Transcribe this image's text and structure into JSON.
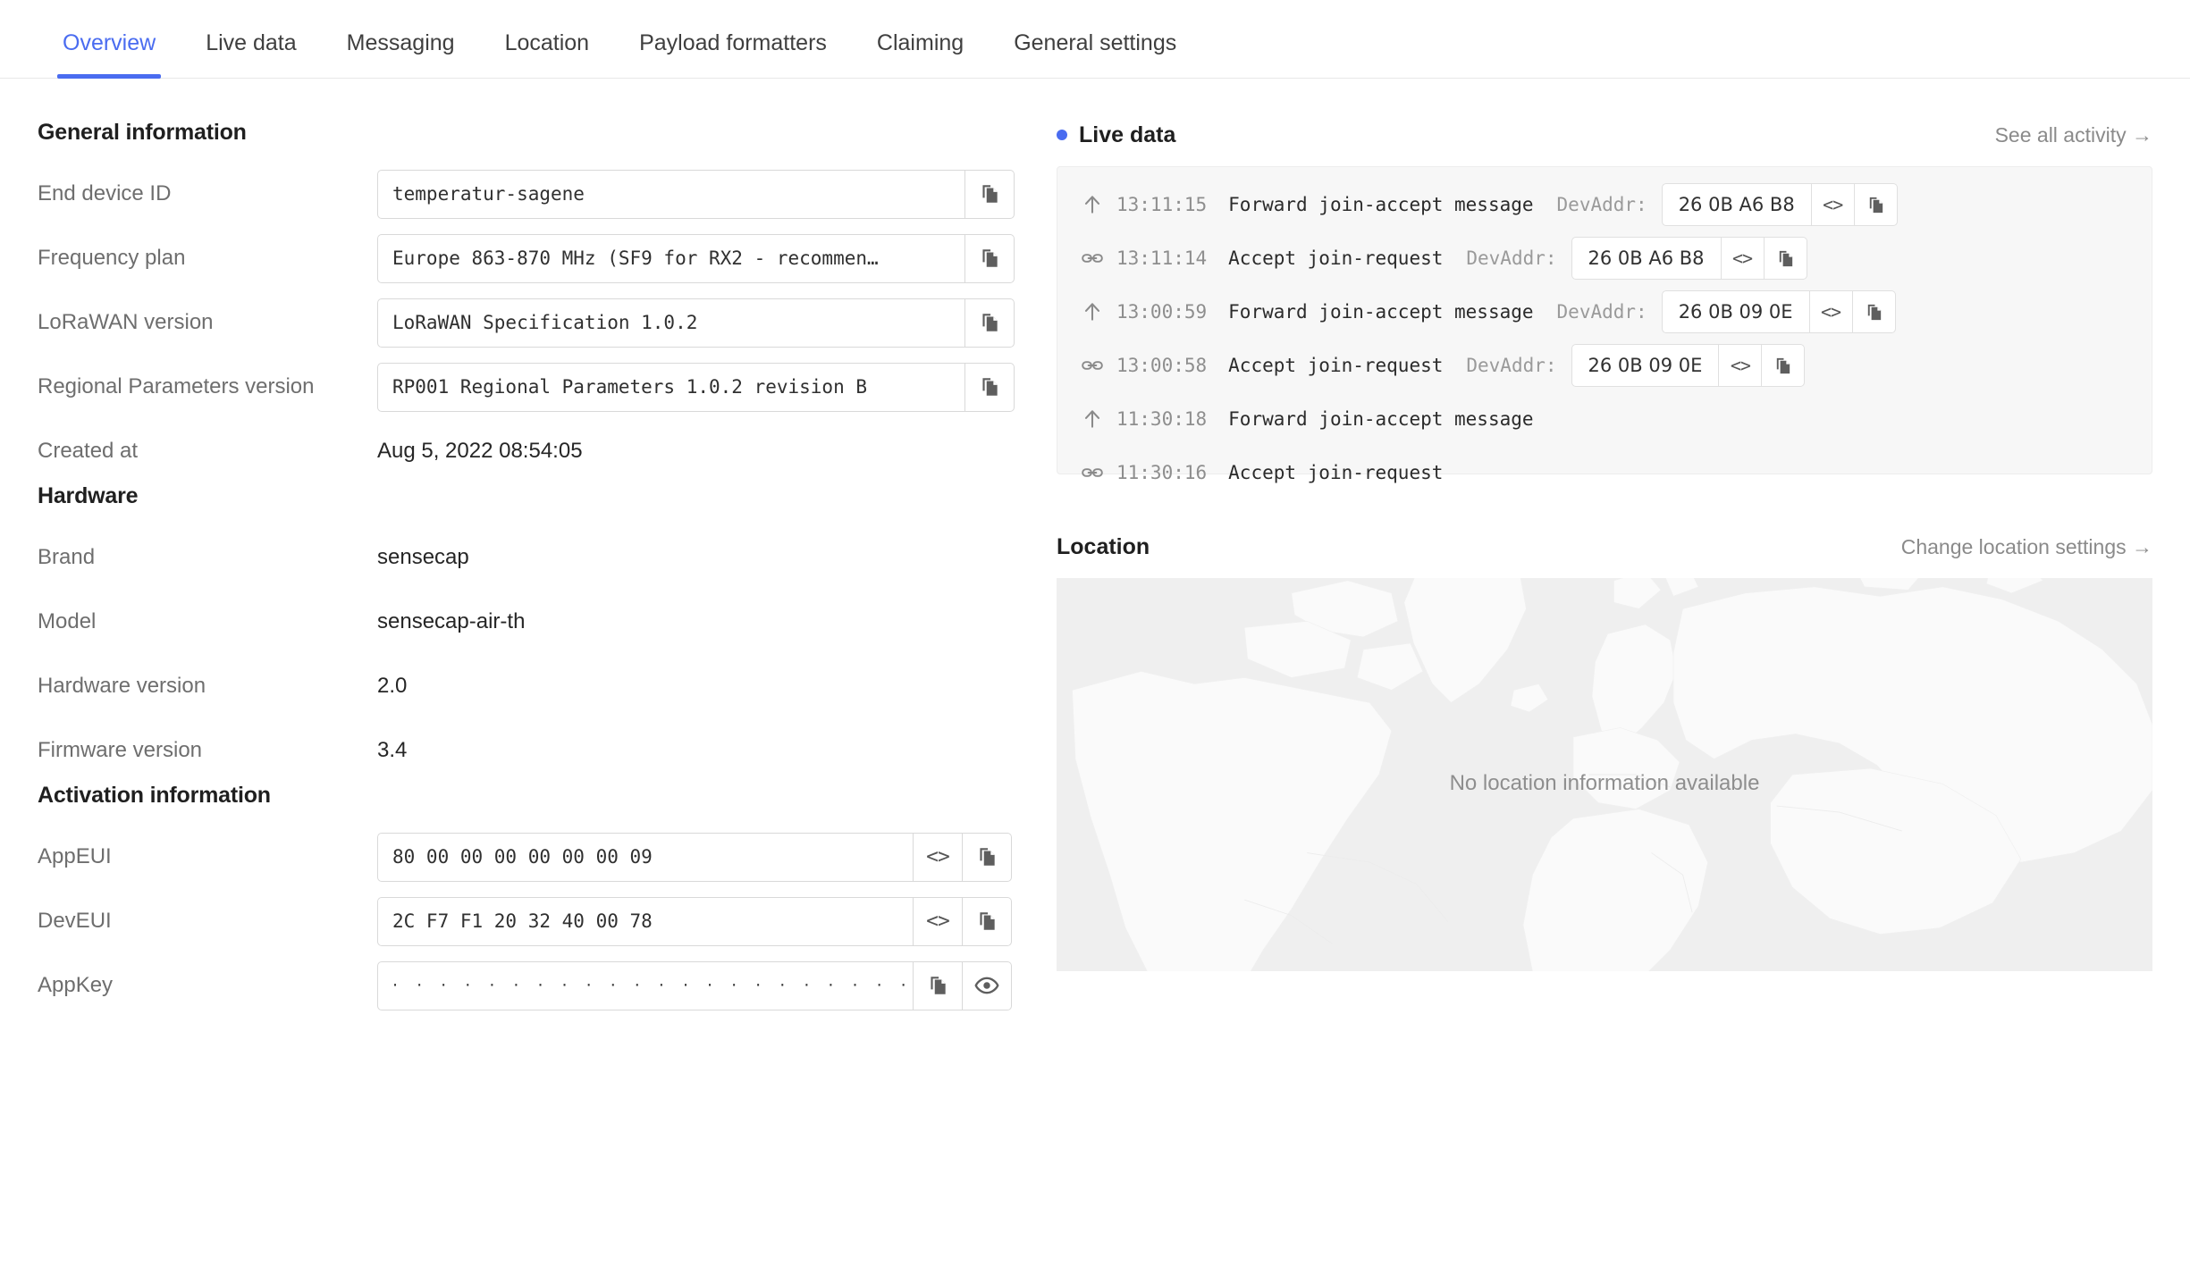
{
  "tabs": [
    {
      "label": "Overview",
      "active": true
    },
    {
      "label": "Live data",
      "active": false
    },
    {
      "label": "Messaging",
      "active": false
    },
    {
      "label": "Location",
      "active": false
    },
    {
      "label": "Payload formatters",
      "active": false
    },
    {
      "label": "Claiming",
      "active": false
    },
    {
      "label": "General settings",
      "active": false
    }
  ],
  "general": {
    "heading": "General information",
    "rows": [
      {
        "label": "End device ID",
        "value": "temperatur-sagene",
        "type": "input-copy"
      },
      {
        "label": "Frequency plan",
        "value": "Europe 863-870 MHz (SF9 for RX2 - recommen…",
        "type": "input-copy"
      },
      {
        "label": "LoRaWAN version",
        "value": "LoRaWAN Specification 1.0.2",
        "type": "input-copy"
      },
      {
        "label": "Regional Parameters version",
        "value": "RP001 Regional Parameters 1.0.2 revision B",
        "type": "input-copy"
      },
      {
        "label": "Created at",
        "value": "Aug 5, 2022 08:54:05",
        "type": "plain"
      }
    ]
  },
  "hardware": {
    "heading": "Hardware",
    "rows": [
      {
        "label": "Brand",
        "value": "sensecap"
      },
      {
        "label": "Model",
        "value": "sensecap-air-th"
      },
      {
        "label": "Hardware version",
        "value": "2.0"
      },
      {
        "label": "Firmware version",
        "value": "3.4"
      }
    ]
  },
  "activation": {
    "heading": "Activation information",
    "rows": [
      {
        "label": "AppEUI",
        "value": "80 00 00 00 00 00 00 09",
        "buttons": [
          "code-icon",
          "copy-icon"
        ]
      },
      {
        "label": "DevEUI",
        "value": "2C F7 F1 20 32 40 00 78",
        "buttons": [
          "code-icon",
          "copy-icon"
        ]
      },
      {
        "label": "AppKey",
        "value": "· · · · · · · · · · · · · · · · · · · · · · · · · · · · · · · ·",
        "masked": true,
        "buttons": [
          "copy-icon",
          "eye-icon"
        ]
      }
    ]
  },
  "livedata": {
    "title": "Live data",
    "link": "See all activity →",
    "rows": [
      {
        "icon": "arrow-up-icon",
        "time": "13:11:15",
        "message": "Forward join-accept message",
        "dev_label": "DevAddr:",
        "dev_value": "26 0B A6 B8"
      },
      {
        "icon": "link-icon",
        "time": "13:11:14",
        "message": "Accept join-request",
        "dev_label": "DevAddr:",
        "dev_value": "26 0B A6 B8"
      },
      {
        "icon": "arrow-up-icon",
        "time": "13:00:59",
        "message": "Forward join-accept message",
        "dev_label": "DevAddr:",
        "dev_value": "26 0B 09 0E"
      },
      {
        "icon": "link-icon",
        "time": "13:00:58",
        "message": "Accept join-request",
        "dev_label": "DevAddr:",
        "dev_value": "26 0B 09 0E"
      },
      {
        "icon": "arrow-up-icon",
        "time": "11:30:18",
        "message": "Forward join-accept message",
        "dev_label": "",
        "dev_value": ""
      },
      {
        "icon": "link-icon",
        "time": "11:30:16",
        "message": "Accept join-request",
        "dev_label": "",
        "dev_value": ""
      }
    ]
  },
  "location": {
    "title": "Location",
    "link": "Change location settings →",
    "empty_text": "No location information available"
  },
  "colors": {
    "accent": "#4a6cf0",
    "label_gray": "#6e6e6e",
    "panel_bg": "#f7f7f7",
    "map_bg": "#efefef",
    "map_land": "#fbfbfb"
  }
}
